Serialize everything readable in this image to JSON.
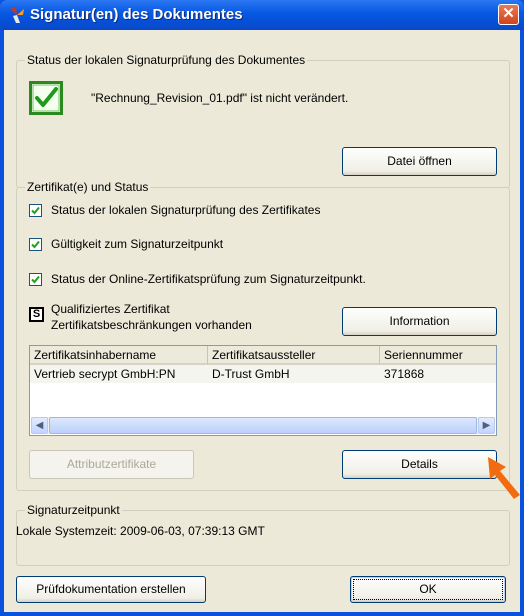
{
  "window": {
    "title": "Signatur(en) des Dokumentes",
    "close_glyph": "✕"
  },
  "doc_status": {
    "legend": "Status der lokalen Signaturprüfung des Dokumentes",
    "message": "\"Rechnung_Revision_01.pdf\" ist nicht verändert.",
    "open_button": "Datei öffnen"
  },
  "cert_status": {
    "legend": "Zertifikat(e) und Status",
    "checks": [
      "Status der lokalen Signaturprüfung des Zertifikates",
      "Gültigkeit zum Signaturzeitpunkt",
      "Status der Online-Zertifikatsprüfung zum Signaturzeitpunkt."
    ],
    "qualified_badge": "S",
    "qualified_line1": "Qualifiziertes Zertifikat",
    "qualified_line2": "Zertifikatsbeschränkungen vorhanden",
    "info_button": "Information",
    "table": {
      "columns": [
        "Zertifikatsinhabername",
        "Zertifikatsaussteller",
        "Seriennummer"
      ],
      "rows": [
        [
          "Vertrieb secrypt GmbH:PN",
          "D-Trust GmbH",
          "371868"
        ]
      ]
    },
    "attr_button": "Attributzertifikate",
    "details_button": "Details"
  },
  "signature_time": {
    "legend": "Signaturzeitpunkt",
    "text": "Lokale Systemzeit: 2009-06-03, 07:39:13 GMT"
  },
  "footer": {
    "report_button": "Prüfdokumentation erstellen",
    "ok_button": "OK"
  },
  "colors": {
    "titlebar": "#0a52dd",
    "dialog": "#ece9d8",
    "check": "#21a121",
    "arrow": "#f26b0f"
  }
}
